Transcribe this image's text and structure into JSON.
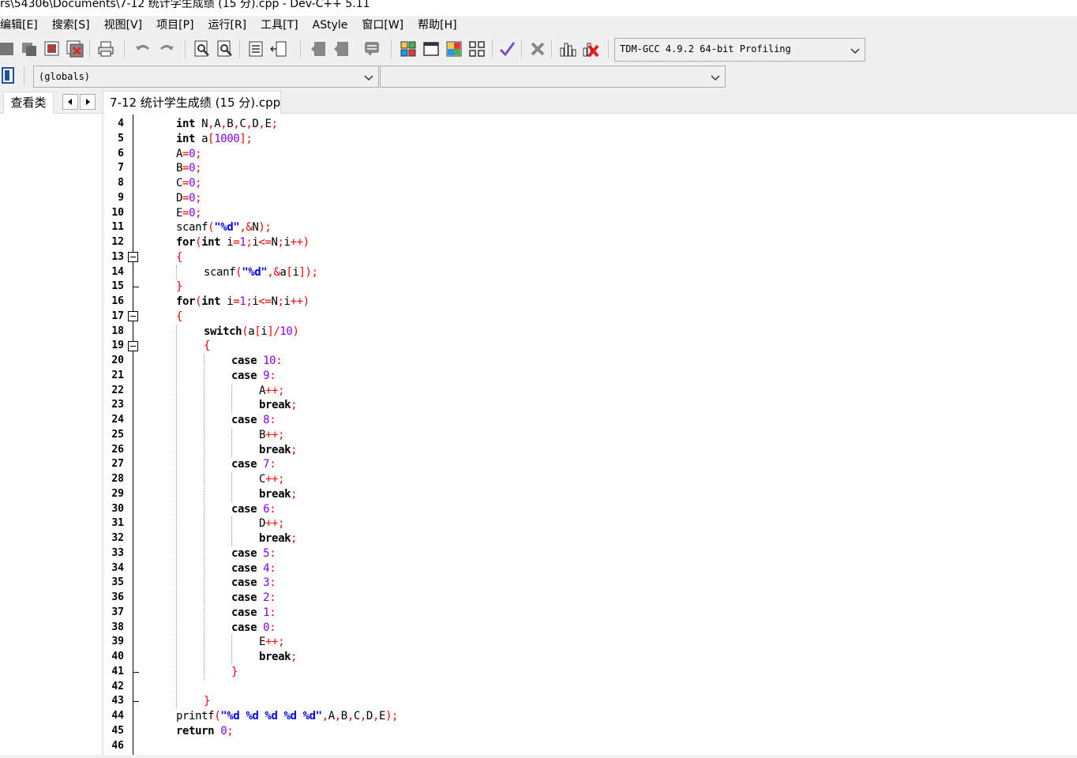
{
  "window": {
    "title": "rs\\54306\\Documents\\7-12 统计学生成绩 (15 分).cpp - Dev-C++ 5.11"
  },
  "menu": {
    "items": [
      "编辑[E]",
      "搜索[S]",
      "视图[V]",
      "项目[P]",
      "运行[R]",
      "工具[T]",
      "AStyle",
      "窗口[W]",
      "帮助[H]"
    ]
  },
  "toolbar": {
    "compiler": "TDM-GCC 4.9.2 64-bit Profiling",
    "scope": "(globals)",
    "member": ""
  },
  "tabs": {
    "class_tab": "查看类",
    "file_tab": "7-12 统计学生成绩 (15 分).cpp"
  },
  "colors": {
    "keyword": "#000000",
    "number": "#8000ff",
    "string": "#0000ff",
    "symbol": "#ff0000",
    "background": "#ffffff",
    "chrome": "#f0f0f0"
  },
  "editor": {
    "lines": [
      {
        "n": "4",
        "indent": 0,
        "tokens": [
          [
            "kw",
            "int"
          ],
          [
            "plain",
            " N"
          ],
          [
            "sym",
            ","
          ],
          [
            "plain",
            "A"
          ],
          [
            "sym",
            ","
          ],
          [
            "plain",
            "B"
          ],
          [
            "sym",
            ","
          ],
          [
            "plain",
            "C"
          ],
          [
            "sym",
            ","
          ],
          [
            "plain",
            "D"
          ],
          [
            "sym",
            ","
          ],
          [
            "plain",
            "E"
          ],
          [
            "sym",
            ";"
          ]
        ]
      },
      {
        "n": "5",
        "indent": 0,
        "tokens": [
          [
            "kw",
            "int"
          ],
          [
            "plain",
            " a"
          ],
          [
            "sym",
            "["
          ],
          [
            "num",
            "1000"
          ],
          [
            "sym",
            "];"
          ]
        ]
      },
      {
        "n": "6",
        "indent": 0,
        "tokens": [
          [
            "plain",
            "A"
          ],
          [
            "sym",
            "="
          ],
          [
            "num",
            "0"
          ],
          [
            "sym",
            ";"
          ]
        ]
      },
      {
        "n": "7",
        "indent": 0,
        "tokens": [
          [
            "plain",
            "B"
          ],
          [
            "sym",
            "="
          ],
          [
            "num",
            "0"
          ],
          [
            "sym",
            ";"
          ]
        ]
      },
      {
        "n": "8",
        "indent": 0,
        "tokens": [
          [
            "plain",
            "C"
          ],
          [
            "sym",
            "="
          ],
          [
            "num",
            "0"
          ],
          [
            "sym",
            ";"
          ]
        ]
      },
      {
        "n": "9",
        "indent": 0,
        "tokens": [
          [
            "plain",
            "D"
          ],
          [
            "sym",
            "="
          ],
          [
            "num",
            "0"
          ],
          [
            "sym",
            ";"
          ]
        ]
      },
      {
        "n": "10",
        "indent": 0,
        "tokens": [
          [
            "plain",
            "E"
          ],
          [
            "sym",
            "="
          ],
          [
            "num",
            "0"
          ],
          [
            "sym",
            ";"
          ]
        ]
      },
      {
        "n": "11",
        "indent": 0,
        "tokens": [
          [
            "plain",
            "scanf"
          ],
          [
            "sym",
            "("
          ],
          [
            "str",
            "\"%d\""
          ],
          [
            "sym",
            ",&"
          ],
          [
            "plain",
            "N"
          ],
          [
            "sym",
            ");"
          ]
        ]
      },
      {
        "n": "12",
        "indent": 0,
        "tokens": [
          [
            "kw",
            "for"
          ],
          [
            "sym",
            "("
          ],
          [
            "kw",
            "int"
          ],
          [
            "plain",
            " i"
          ],
          [
            "sym",
            "="
          ],
          [
            "num",
            "1"
          ],
          [
            "sym",
            ";"
          ],
          [
            "plain",
            "i"
          ],
          [
            "sym",
            "<="
          ],
          [
            "plain",
            "N"
          ],
          [
            "sym",
            ";"
          ],
          [
            "plain",
            "i"
          ],
          [
            "sym",
            "++)"
          ]
        ]
      },
      {
        "n": "13",
        "indent": 0,
        "tokens": [
          [
            "sym",
            "{"
          ]
        ]
      },
      {
        "n": "14",
        "indent": 1,
        "tokens": [
          [
            "plain",
            "scanf"
          ],
          [
            "sym",
            "("
          ],
          [
            "str",
            "\"%d\""
          ],
          [
            "sym",
            ",&"
          ],
          [
            "plain",
            "a"
          ],
          [
            "sym",
            "["
          ],
          [
            "plain",
            "i"
          ],
          [
            "sym",
            "]);"
          ]
        ]
      },
      {
        "n": "15",
        "indent": 0,
        "tokens": [
          [
            "sym",
            "}"
          ]
        ]
      },
      {
        "n": "16",
        "indent": 0,
        "tokens": [
          [
            "kw",
            "for"
          ],
          [
            "sym",
            "("
          ],
          [
            "kw",
            "int"
          ],
          [
            "plain",
            " i"
          ],
          [
            "sym",
            "="
          ],
          [
            "num",
            "1"
          ],
          [
            "sym",
            ";"
          ],
          [
            "plain",
            "i"
          ],
          [
            "sym",
            "<="
          ],
          [
            "plain",
            "N"
          ],
          [
            "sym",
            ";"
          ],
          [
            "plain",
            "i"
          ],
          [
            "sym",
            "++)"
          ]
        ]
      },
      {
        "n": "17",
        "indent": 0,
        "tokens": [
          [
            "sym",
            "{"
          ]
        ]
      },
      {
        "n": "18",
        "indent": 1,
        "tokens": [
          [
            "kw",
            "switch"
          ],
          [
            "sym",
            "("
          ],
          [
            "plain",
            "a"
          ],
          [
            "sym",
            "["
          ],
          [
            "plain",
            "i"
          ],
          [
            "sym",
            "]/"
          ],
          [
            "num",
            "10"
          ],
          [
            "sym",
            ")"
          ]
        ]
      },
      {
        "n": "19",
        "indent": 1,
        "tokens": [
          [
            "sym",
            "{"
          ]
        ]
      },
      {
        "n": "20",
        "indent": 2,
        "tokens": [
          [
            "kw",
            "case"
          ],
          [
            "plain",
            " "
          ],
          [
            "num",
            "10"
          ],
          [
            "sym",
            ":"
          ]
        ]
      },
      {
        "n": "21",
        "indent": 2,
        "tokens": [
          [
            "kw",
            "case"
          ],
          [
            "plain",
            " "
          ],
          [
            "num",
            "9"
          ],
          [
            "sym",
            ":"
          ]
        ]
      },
      {
        "n": "22",
        "indent": 3,
        "tokens": [
          [
            "plain",
            "A"
          ],
          [
            "sym",
            "++;"
          ]
        ]
      },
      {
        "n": "23",
        "indent": 3,
        "tokens": [
          [
            "kw",
            "break"
          ],
          [
            "sym",
            ";"
          ]
        ]
      },
      {
        "n": "24",
        "indent": 2,
        "tokens": [
          [
            "kw",
            "case"
          ],
          [
            "plain",
            " "
          ],
          [
            "num",
            "8"
          ],
          [
            "sym",
            ":"
          ]
        ]
      },
      {
        "n": "25",
        "indent": 3,
        "tokens": [
          [
            "plain",
            "B"
          ],
          [
            "sym",
            "++;"
          ]
        ]
      },
      {
        "n": "26",
        "indent": 3,
        "tokens": [
          [
            "kw",
            "break"
          ],
          [
            "sym",
            ";"
          ]
        ]
      },
      {
        "n": "27",
        "indent": 2,
        "tokens": [
          [
            "kw",
            "case"
          ],
          [
            "plain",
            " "
          ],
          [
            "num",
            "7"
          ],
          [
            "sym",
            ":"
          ]
        ]
      },
      {
        "n": "28",
        "indent": 3,
        "tokens": [
          [
            "plain",
            "C"
          ],
          [
            "sym",
            "++;"
          ]
        ]
      },
      {
        "n": "29",
        "indent": 3,
        "tokens": [
          [
            "kw",
            "break"
          ],
          [
            "sym",
            ";"
          ]
        ]
      },
      {
        "n": "30",
        "indent": 2,
        "tokens": [
          [
            "kw",
            "case"
          ],
          [
            "plain",
            " "
          ],
          [
            "num",
            "6"
          ],
          [
            "sym",
            ":"
          ]
        ]
      },
      {
        "n": "31",
        "indent": 3,
        "tokens": [
          [
            "plain",
            "D"
          ],
          [
            "sym",
            "++;"
          ]
        ]
      },
      {
        "n": "32",
        "indent": 3,
        "tokens": [
          [
            "kw",
            "break"
          ],
          [
            "sym",
            ";"
          ]
        ]
      },
      {
        "n": "33",
        "indent": 2,
        "tokens": [
          [
            "kw",
            "case"
          ],
          [
            "plain",
            " "
          ],
          [
            "num",
            "5"
          ],
          [
            "sym",
            ":"
          ]
        ]
      },
      {
        "n": "34",
        "indent": 2,
        "tokens": [
          [
            "kw",
            "case"
          ],
          [
            "plain",
            " "
          ],
          [
            "num",
            "4"
          ],
          [
            "sym",
            ":"
          ]
        ]
      },
      {
        "n": "35",
        "indent": 2,
        "tokens": [
          [
            "kw",
            "case"
          ],
          [
            "plain",
            " "
          ],
          [
            "num",
            "3"
          ],
          [
            "sym",
            ":"
          ]
        ]
      },
      {
        "n": "36",
        "indent": 2,
        "tokens": [
          [
            "kw",
            "case"
          ],
          [
            "plain",
            " "
          ],
          [
            "num",
            "2"
          ],
          [
            "sym",
            ":"
          ]
        ]
      },
      {
        "n": "37",
        "indent": 2,
        "tokens": [
          [
            "kw",
            "case"
          ],
          [
            "plain",
            " "
          ],
          [
            "num",
            "1"
          ],
          [
            "sym",
            ":"
          ]
        ]
      },
      {
        "n": "38",
        "indent": 2,
        "tokens": [
          [
            "kw",
            "case"
          ],
          [
            "plain",
            " "
          ],
          [
            "num",
            "0"
          ],
          [
            "sym",
            ":"
          ]
        ]
      },
      {
        "n": "39",
        "indent": 3,
        "tokens": [
          [
            "plain",
            "E"
          ],
          [
            "sym",
            "++;"
          ]
        ]
      },
      {
        "n": "40",
        "indent": 3,
        "tokens": [
          [
            "kw",
            "break"
          ],
          [
            "sym",
            ";"
          ]
        ]
      },
      {
        "n": "41",
        "indent": 2,
        "tokens": [
          [
            "sym",
            "}"
          ]
        ]
      },
      {
        "n": "42",
        "indent": 0,
        "tokens": []
      },
      {
        "n": "43",
        "indent": 1,
        "tokens": [
          [
            "sym",
            "}"
          ]
        ]
      },
      {
        "n": "44",
        "indent": 0,
        "tokens": [
          [
            "plain",
            "printf"
          ],
          [
            "sym",
            "("
          ],
          [
            "str",
            "\"%d %d %d %d %d\""
          ],
          [
            "sym",
            ","
          ],
          [
            "plain",
            "A"
          ],
          [
            "sym",
            ","
          ],
          [
            "plain",
            "B"
          ],
          [
            "sym",
            ","
          ],
          [
            "plain",
            "C"
          ],
          [
            "sym",
            ","
          ],
          [
            "plain",
            "D"
          ],
          [
            "sym",
            ","
          ],
          [
            "plain",
            "E"
          ],
          [
            "sym",
            ");"
          ]
        ]
      },
      {
        "n": "45",
        "indent": 0,
        "tokens": [
          [
            "kw",
            "return"
          ],
          [
            "plain",
            " "
          ],
          [
            "num",
            "0"
          ],
          [
            "sym",
            ";"
          ]
        ]
      },
      {
        "n": "46",
        "indent": 0,
        "tokens": []
      }
    ]
  }
}
